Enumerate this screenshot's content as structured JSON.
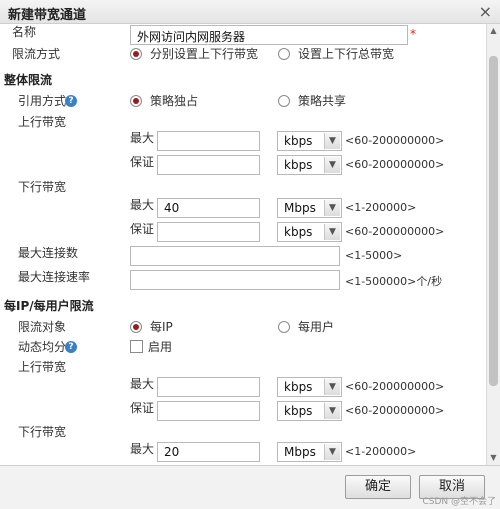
{
  "dialog": {
    "title": "新建带宽通道",
    "close_icon": "×"
  },
  "name_field": {
    "label": "名称",
    "value": "外网访问内网服务器",
    "required_mark": "*"
  },
  "limit_mode": {
    "label": "限流方式",
    "options": [
      "分别设置上下行带宽",
      "设置上下行总带宽"
    ],
    "selected": 0
  },
  "overall": {
    "heading": "整体限流",
    "ref_mode": {
      "label": "引用方式",
      "help": "?",
      "options": [
        "策略独占",
        "策略共享"
      ],
      "selected": 0
    },
    "upstream": {
      "label": "上行带宽",
      "max": {
        "label": "最大",
        "value": "",
        "unit": "kbps",
        "hint": "<60-200000000>"
      },
      "guarantee": {
        "label": "保证",
        "value": "",
        "unit": "kbps",
        "hint": "<60-200000000>"
      }
    },
    "downstream": {
      "label": "下行带宽",
      "max": {
        "label": "最大",
        "value": "40",
        "unit": "Mbps",
        "hint": "<1-200000>"
      },
      "guarantee": {
        "label": "保证",
        "value": "",
        "unit": "kbps",
        "hint": "<60-200000000>"
      }
    },
    "max_conn": {
      "label": "最大连接数",
      "value": "",
      "hint": "<1-5000>"
    },
    "max_conn_rate": {
      "label": "最大连接速率",
      "value": "",
      "hint": "<1-500000>个/秒"
    }
  },
  "per_ip": {
    "heading": "每IP/每用户限流",
    "target": {
      "label": "限流对象",
      "options": [
        "每IP",
        "每用户"
      ],
      "selected": 0
    },
    "dynamic": {
      "label": "动态均分",
      "help": "?",
      "checkbox_label": "启用",
      "checked": false
    },
    "upstream": {
      "label": "上行带宽",
      "max": {
        "label": "最大",
        "value": "",
        "unit": "kbps",
        "hint": "<60-200000000>"
      },
      "guarantee": {
        "label": "保证",
        "value": "",
        "unit": "kbps",
        "hint": "<60-200000000>"
      }
    },
    "downstream": {
      "label": "下行带宽",
      "max": {
        "label": "最大",
        "value": "20",
        "unit": "Mbps",
        "hint": "<1-200000>"
      }
    }
  },
  "footer": {
    "ok": "确定",
    "cancel": "取消",
    "watermark": "CSDN @空不会了"
  },
  "icons": {
    "dropdown": "▼",
    "scroll_up": "▲",
    "scroll_down": "▼"
  }
}
